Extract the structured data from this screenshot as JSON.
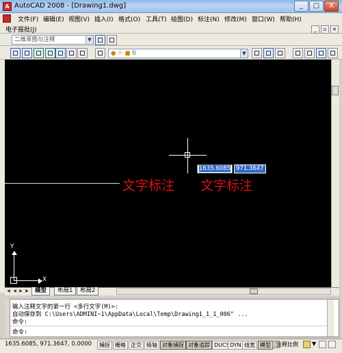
{
  "window": {
    "title": "AutoCAD 2008 - [Drawing1.dwg]",
    "min": "_",
    "max": "□",
    "close": "X"
  },
  "menu": {
    "items": [
      "文件(F)",
      "编辑(E)",
      "视图(V)",
      "插入(I)",
      "格式(O)",
      "工具(T)",
      "绘图(D)",
      "标注(N)",
      "修改(M)",
      "窗口(W)",
      "帮助(H)"
    ],
    "second_row": "电子报批(J)",
    "mdi_min": "_",
    "mdi_restore": "▫",
    "mdi_close": "×"
  },
  "toolbar": {
    "workspace": "二维草图与注释",
    "layer": "0",
    "arrow": "▼"
  },
  "canvas": {
    "coord_x": "1635.6085",
    "coord_y": "971.3647",
    "annotation_1": "文字标注",
    "annotation_2": "文字标注",
    "ucs_y": "Y",
    "ucs_x": "X"
  },
  "tabs": {
    "model": "模型",
    "layout1": "布局1",
    "layout2": "布局2"
  },
  "command": {
    "line1": "输入注释文字的第一行 <多行文字(M)>:",
    "line2": "自动保存到 C:\\Users\\ADMINI~1\\AppData\\Local\\Temp\\Drawing1_1_1_006\" ...",
    "line3": "命令:",
    "line4": "命令:"
  },
  "status": {
    "coords": "1635.6085,  971.3647,  0.0000",
    "buttons": [
      "捕捉",
      "栅格",
      "正交",
      "极轴",
      "对象捕捉",
      "对象追踪",
      "DUCS",
      "DYN",
      "线宽",
      "模型"
    ],
    "annotation_scale": "注释比例"
  }
}
